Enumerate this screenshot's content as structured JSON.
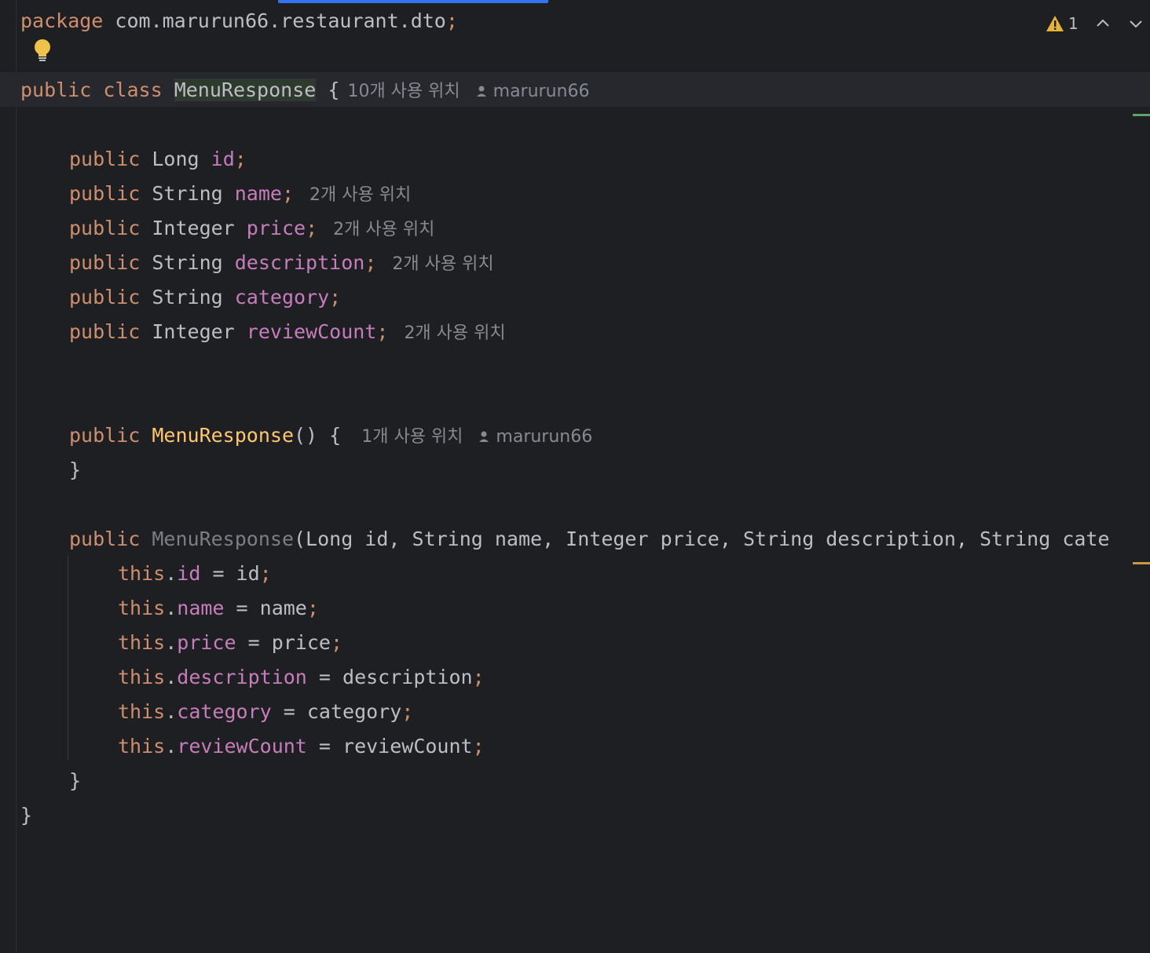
{
  "editor": {
    "warnings": {
      "count": "1"
    },
    "lines": {
      "package_kw": "package",
      "package_name": "com.marurun66.restaurant.dto",
      "package_semi": ";",
      "class_public": "public",
      "class_kw": "class",
      "class_name": "MenuResponse",
      "class_brace": "{",
      "class_usages": "10개 사용 위치",
      "class_author": "marurun66",
      "fields": [
        {
          "mod": "public",
          "type": "Long",
          "name": "id",
          "semi": ";",
          "usages": ""
        },
        {
          "mod": "public",
          "type": "String",
          "name": "name",
          "semi": ";",
          "usages": "2개 사용 위치"
        },
        {
          "mod": "public",
          "type": "Integer",
          "name": "price",
          "semi": ";",
          "usages": "2개 사용 위치"
        },
        {
          "mod": "public",
          "type": "String",
          "name": "description",
          "semi": ";",
          "usages": "2개 사용 위치"
        },
        {
          "mod": "public",
          "type": "String",
          "name": "category",
          "semi": ";",
          "usages": ""
        },
        {
          "mod": "public",
          "type": "Integer",
          "name": "reviewCount",
          "semi": ";",
          "usages": "2개 사용 위치"
        }
      ],
      "ctor1_mod": "public",
      "ctor1_name": "MenuResponse",
      "ctor1_sig": "() {",
      "ctor1_usages": "1개 사용 위치",
      "ctor1_author": "marurun66",
      "ctor1_close": "}",
      "ctor2_mod": "public",
      "ctor2_name": "MenuResponse",
      "ctor2_params": "(Long id, String name, Integer price, String description, String cate",
      "assignments": [
        {
          "this": "this",
          "dot": ".",
          "field": "id",
          "eq": " = ",
          "value": "id",
          "semi": ";"
        },
        {
          "this": "this",
          "dot": ".",
          "field": "name",
          "eq": " = ",
          "value": "name",
          "semi": ";"
        },
        {
          "this": "this",
          "dot": ".",
          "field": "price",
          "eq": " = ",
          "value": "price",
          "semi": ";"
        },
        {
          "this": "this",
          "dot": ".",
          "field": "description",
          "eq": " = ",
          "value": "description",
          "semi": ";"
        },
        {
          "this": "this",
          "dot": ".",
          "field": "category",
          "eq": " = ",
          "value": "category",
          "semi": ";"
        },
        {
          "this": "this",
          "dot": ".",
          "field": "reviewCount",
          "eq": " = ",
          "value": "reviewCount",
          "semi": ";"
        }
      ],
      "ctor2_close": "}",
      "class_close": "}"
    }
  },
  "icons": {
    "bulb": "lightbulb-icon",
    "warning": "warning-triangle-icon",
    "prev": "chevron-up-icon",
    "next": "chevron-down-icon",
    "author": "person-icon"
  },
  "colors": {
    "background": "#1e1f22",
    "keyword": "#cf8e6d",
    "field": "#c77dbb",
    "method": "#ffc66d",
    "text": "#bcbec4",
    "hint": "#868a91"
  }
}
